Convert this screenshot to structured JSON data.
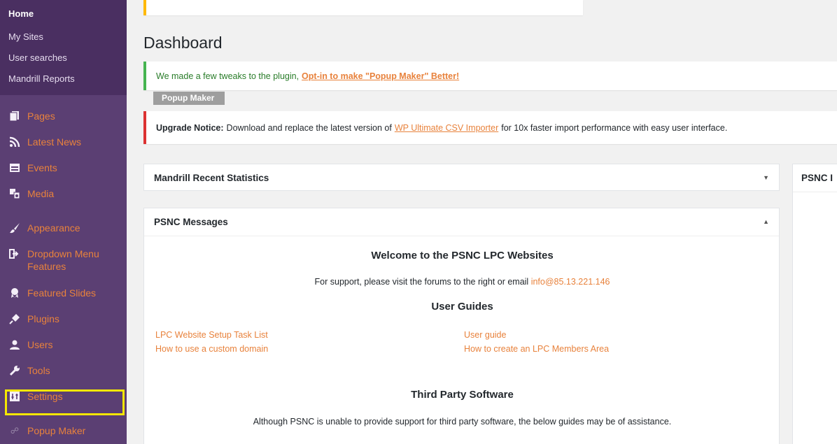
{
  "sidebar": {
    "submenu": [
      "Home",
      "My Sites",
      "User searches",
      "Mandrill Reports"
    ],
    "items": [
      {
        "label": "Pages",
        "icon": "pages-icon"
      },
      {
        "label": "Latest News",
        "icon": "rss-icon"
      },
      {
        "label": "Events",
        "icon": "calendar-icon"
      },
      {
        "label": "Media",
        "icon": "media-icon"
      },
      {
        "label": "Appearance",
        "icon": "paintbrush-icon"
      },
      {
        "label": "Dropdown Menu Features",
        "icon": "exit-arrow-icon"
      },
      {
        "label": "Featured Slides",
        "icon": "award-icon"
      },
      {
        "label": "Plugins",
        "icon": "plug-icon"
      },
      {
        "label": "Users",
        "icon": "user-icon"
      },
      {
        "label": "Tools",
        "icon": "wrench-icon"
      },
      {
        "label": "Settings",
        "icon": "settings-icon"
      },
      {
        "label": "Popup Maker",
        "icon": "popup-icon"
      }
    ]
  },
  "page": {
    "title": "Dashboard"
  },
  "notices": {
    "green_text": "We made a few tweaks to the plugin,",
    "green_link": "Opt-in to make \"Popup Maker\" Better!",
    "tag": "Popup Maker",
    "red_bold": "Upgrade Notice:",
    "red_text1": "Download and replace the latest version of",
    "red_link": "WP Ultimate CSV Importer",
    "red_text2": "for 10x faster import performance with easy user interface."
  },
  "boxes": {
    "mandrill_title": "Mandrill Recent Statistics",
    "messages_title": "PSNC Messages",
    "side_title": "PSNC I"
  },
  "messages": {
    "welcome": "Welcome to the PSNC LPC Websites",
    "support_text": "For support, please visit the forums to the right or email",
    "support_email": "info@85.13.221.146",
    "guides_heading": "User Guides",
    "links": [
      "LPC Website Setup Task List",
      "User guide",
      "How to use a custom domain",
      "How to create an LPC Members Area"
    ],
    "third_heading": "Third Party Software",
    "third_text": "Although PSNC is unable to provide support for third party software, the below guides may be of assistance."
  },
  "colors": {
    "sidebar": "#5b3f73",
    "accent": "#e8823c",
    "highlight": "#f5e700"
  }
}
